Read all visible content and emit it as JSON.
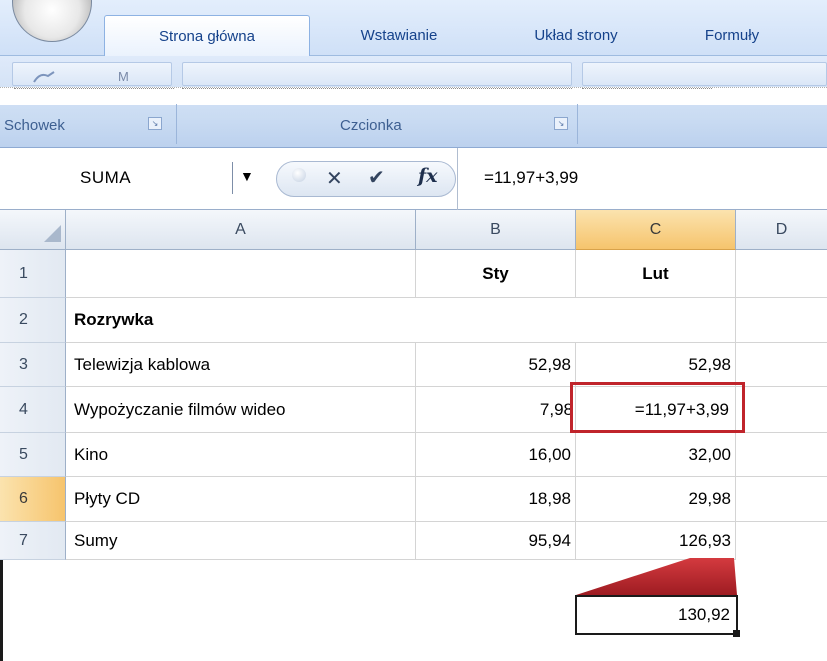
{
  "ribbon": {
    "tabs": [
      {
        "label": "Strona główna",
        "active": true
      },
      {
        "label": "Wstawianie",
        "active": false
      },
      {
        "label": "Układ strony",
        "active": false
      },
      {
        "label": "Formuły",
        "active": false
      }
    ],
    "groups": [
      "Schowek",
      "Czcionka"
    ],
    "clipboard_partial": "M"
  },
  "formula_bar": {
    "name_box": "SUMA",
    "fx_label": "fx",
    "formula": "=11,97+3,99"
  },
  "sheet": {
    "columns": [
      "A",
      "B",
      "C",
      "D"
    ],
    "selected_column": "C",
    "rows": [
      {
        "num": "1",
        "a": "",
        "b": "Sty",
        "c": "Lut"
      },
      {
        "num": "2",
        "a": "Rozrywka",
        "b": "",
        "c": ""
      },
      {
        "num": "3",
        "a": "Telewizja kablowa",
        "b": "52,98",
        "c": "52,98"
      },
      {
        "num": "4",
        "a": "Wypożyczanie filmów wideo",
        "b": "7,98",
        "c": "=11,97+3,99"
      },
      {
        "num": "5",
        "a": "Kino",
        "b": "16,00",
        "c": "32,00"
      },
      {
        "num": "6",
        "a": "Płyty CD",
        "b": "18,98",
        "c": "29,98"
      },
      {
        "num": "7",
        "a": "Sumy",
        "b": "95,94",
        "c": "126,93"
      }
    ],
    "selected_row": "6"
  },
  "callout": {
    "value": "130,92"
  },
  "colors": {
    "highlight_border": "#c0242b",
    "callout_fill": "#c1272d",
    "selected_header": "#f6c46d"
  }
}
